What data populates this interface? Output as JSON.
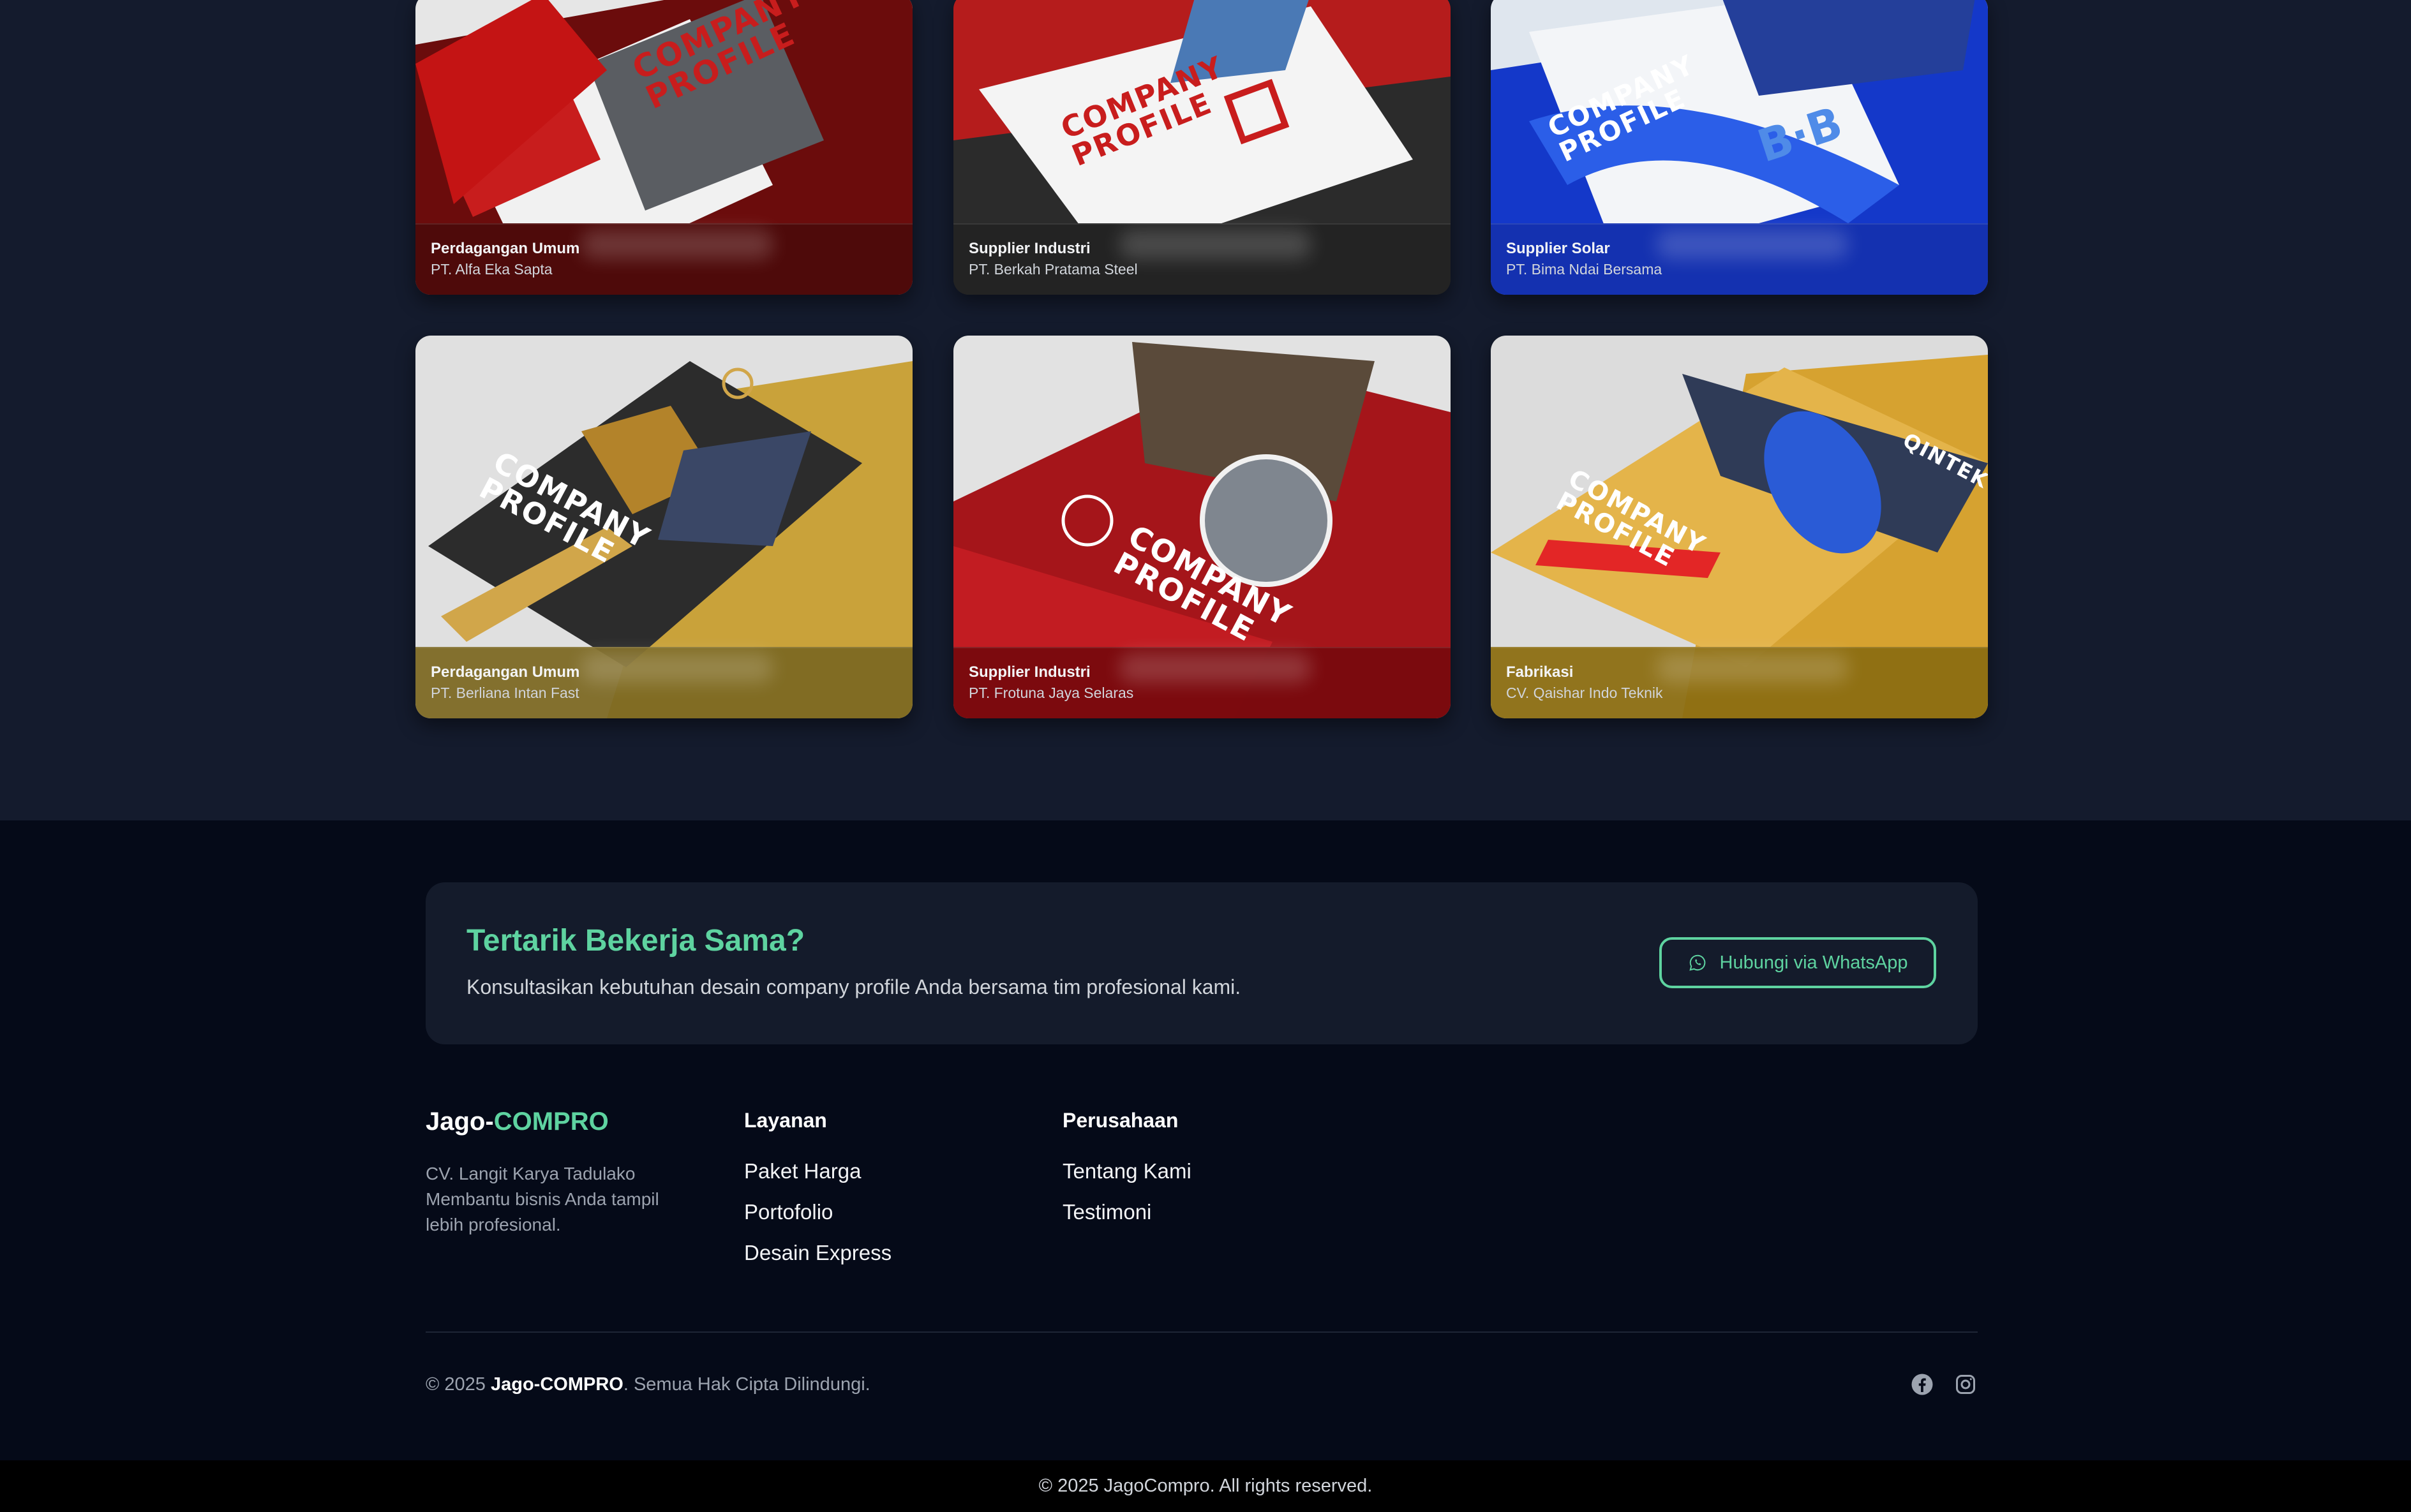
{
  "portfolio": {
    "cards": [
      {
        "category": "Perdagangan Umum",
        "company": "PT. Alfa Eka Sapta",
        "cover_title": "COMPANY PROFILE",
        "tint": "#5a0b0b"
      },
      {
        "category": "Supplier Industri",
        "company": "PT. Berkah Pratama Steel",
        "cover_title": "COMPANY PROFILE",
        "tint": "#2a2a2a"
      },
      {
        "category": "Supplier Solar",
        "company": "PT. Bima Ndai Bersama",
        "cover_title": "COMPANY PROFILE",
        "tint": "#1434b8"
      },
      {
        "category": "Perdagangan Umum",
        "company": "PT. Berliana Intan Fast",
        "cover_title": "COMPANY PROFILE",
        "tint": "#8a7426"
      },
      {
        "category": "Supplier Industri",
        "company": "PT. Frotuna Jaya Selaras",
        "cover_title": "COMPANY PROFILE",
        "tint": "#7a0c10"
      },
      {
        "category": "Fabrikasi",
        "company": "CV. Qaishar Indo Teknik",
        "cover_title": "COMPANY PROFILE",
        "brand_mark": "QINTEK",
        "tint": "#8c6e12"
      }
    ]
  },
  "cta": {
    "title": "Tertarik Bekerja Sama?",
    "subtitle": "Konsultasikan kebutuhan desain company profile Anda bersama tim profesional kami.",
    "button_label": "Hubungi via WhatsApp"
  },
  "footer": {
    "brand_main": "Jago-",
    "brand_accent": "COMPRO",
    "about_line1": "CV. Langit Karya Tadulako",
    "about_line2": "Membantu bisnis Anda tampil lebih profesional.",
    "services_title": "Layanan",
    "services": [
      "Paket Harga",
      "Portofolio",
      "Desain Express"
    ],
    "company_title": "Perusahaan",
    "company_links": [
      "Tentang Kami",
      "Testimoni"
    ],
    "copyright_prefix": "© 2025 ",
    "copyright_brand": "Jago-COMPRO",
    "copyright_suffix": ". Semua Hak Cipta Dilindungi.",
    "social_icons": [
      "facebook-icon",
      "instagram-icon"
    ]
  },
  "bottom_bar": {
    "text": "© 2025 JagoCompro. All rights reserved."
  },
  "colors": {
    "accent": "#5ed3a0",
    "page_bg": "#141b2d",
    "footer_bg": "#050a18"
  }
}
